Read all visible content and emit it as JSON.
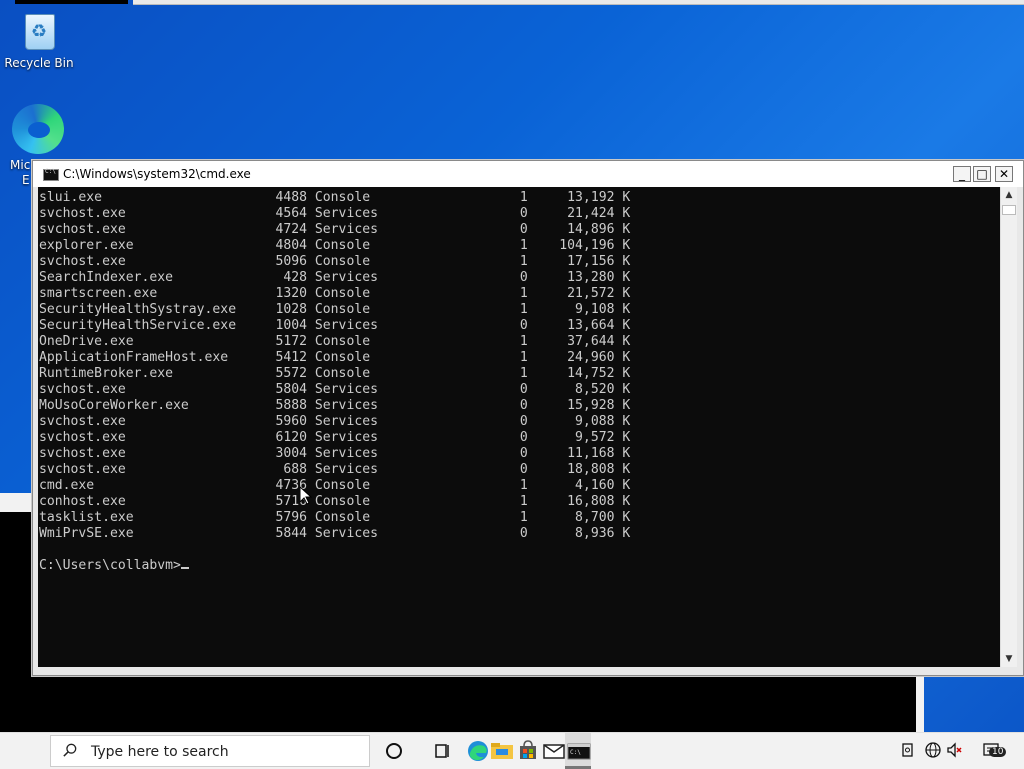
{
  "desktop": {
    "recycle_bin_label": "Recycle Bin",
    "edge_label_line1": "Mic",
    "edge_label_line2": "E"
  },
  "window": {
    "title": "C:\\Windows\\system32\\cmd.exe",
    "minimize": "_",
    "maximize": "□",
    "close": "✕"
  },
  "console": {
    "processes": [
      {
        "name": "slui.exe",
        "pid": "4488",
        "session": "Console",
        "num": "1",
        "mem": "13,192 K"
      },
      {
        "name": "svchost.exe",
        "pid": "4564",
        "session": "Services",
        "num": "0",
        "mem": "21,424 K"
      },
      {
        "name": "svchost.exe",
        "pid": "4724",
        "session": "Services",
        "num": "0",
        "mem": "14,896 K"
      },
      {
        "name": "explorer.exe",
        "pid": "4804",
        "session": "Console",
        "num": "1",
        "mem": "104,196 K"
      },
      {
        "name": "svchost.exe",
        "pid": "5096",
        "session": "Console",
        "num": "1",
        "mem": "17,156 K"
      },
      {
        "name": "SearchIndexer.exe",
        "pid": "428",
        "session": "Services",
        "num": "0",
        "mem": "13,280 K"
      },
      {
        "name": "smartscreen.exe",
        "pid": "1320",
        "session": "Console",
        "num": "1",
        "mem": "21,572 K"
      },
      {
        "name": "SecurityHealthSystray.exe",
        "pid": "1028",
        "session": "Console",
        "num": "1",
        "mem": "9,108 K"
      },
      {
        "name": "SecurityHealthService.exe",
        "pid": "1004",
        "session": "Services",
        "num": "0",
        "mem": "13,664 K"
      },
      {
        "name": "OneDrive.exe",
        "pid": "5172",
        "session": "Console",
        "num": "1",
        "mem": "37,644 K"
      },
      {
        "name": "ApplicationFrameHost.exe",
        "pid": "5412",
        "session": "Console",
        "num": "1",
        "mem": "24,960 K"
      },
      {
        "name": "RuntimeBroker.exe",
        "pid": "5572",
        "session": "Console",
        "num": "1",
        "mem": "14,752 K"
      },
      {
        "name": "svchost.exe",
        "pid": "5804",
        "session": "Services",
        "num": "0",
        "mem": "8,520 K"
      },
      {
        "name": "MoUsoCoreWorker.exe",
        "pid": "5888",
        "session": "Services",
        "num": "0",
        "mem": "15,928 K"
      },
      {
        "name": "svchost.exe",
        "pid": "5960",
        "session": "Services",
        "num": "0",
        "mem": "9,088 K"
      },
      {
        "name": "svchost.exe",
        "pid": "6120",
        "session": "Services",
        "num": "0",
        "mem": "9,572 K"
      },
      {
        "name": "svchost.exe",
        "pid": "3004",
        "session": "Services",
        "num": "0",
        "mem": "11,168 K"
      },
      {
        "name": "svchost.exe",
        "pid": "688",
        "session": "Services",
        "num": "0",
        "mem": "18,808 K"
      },
      {
        "name": "cmd.exe",
        "pid": "4736",
        "session": "Console",
        "num": "1",
        "mem": "4,160 K"
      },
      {
        "name": "conhost.exe",
        "pid": "5716",
        "session": "Console",
        "num": "1",
        "mem": "16,808 K"
      },
      {
        "name": "tasklist.exe",
        "pid": "5796",
        "session": "Console",
        "num": "1",
        "mem": "8,700 K"
      },
      {
        "name": "WmiPrvSE.exe",
        "pid": "5844",
        "session": "Services",
        "num": "0",
        "mem": "8,936 K"
      }
    ],
    "prompt": "C:\\Users\\collabvm>"
  },
  "taskbar": {
    "search_placeholder": "Type here to search",
    "notification_count": "10"
  },
  "colors": {
    "console_bg": "#0c0c0c",
    "console_fg": "#cccccc",
    "desktop_blue": "#0a63d6"
  }
}
